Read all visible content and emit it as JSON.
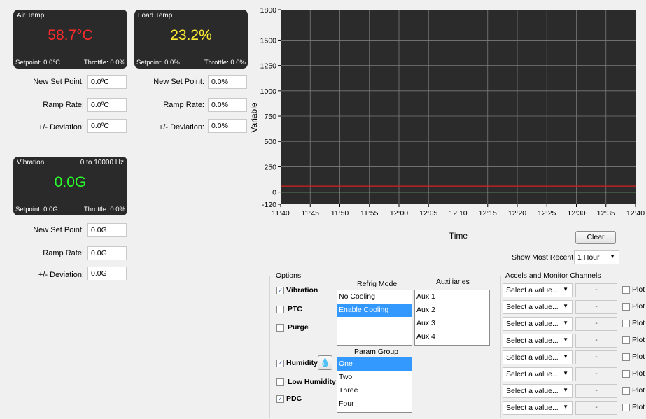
{
  "air": {
    "title": "Air Temp",
    "value": "58.7°C",
    "setpoint": "Setpoint: 0.0°C",
    "throttle": "Throttle: 0.0%",
    "color": "#ff2b2b"
  },
  "load": {
    "title": "Load Temp",
    "value": "23.2%",
    "setpoint": "Setpoint: 0.0%",
    "throttle": "Throttle: 0.0%",
    "color": "#ffee33"
  },
  "vib": {
    "title": "Vibration",
    "range": "0 to 10000 Hz",
    "value": "0.0G",
    "setpoint": "Setpoint: 0.0G",
    "throttle": "Throttle: 0.0%",
    "color": "#2bff2b"
  },
  "labels": {
    "new_set_point": "New Set Point:",
    "ramp_rate": "Ramp Rate:",
    "deviation": "+/- Deviation:"
  },
  "air_inputs": {
    "set_point": "0.0ºC",
    "ramp": "0.0ºC",
    "deviation": "0.0ºC"
  },
  "load_inputs": {
    "set_point": "0.0%",
    "ramp": "0.0%",
    "deviation": "0.0%"
  },
  "vib_inputs": {
    "set_point": "0.0G",
    "ramp": "0.0G",
    "deviation": "0.0G"
  },
  "chart_data": {
    "type": "line",
    "xlabel": "Time",
    "ylabel": "Variable",
    "ylim": [
      -120,
      1800
    ],
    "yticks": [
      "1800",
      "1500",
      "1250",
      "1000",
      "750",
      "500",
      "250",
      "0",
      "-120"
    ],
    "xticks": [
      "11:40",
      "11:45",
      "11:50",
      "11:55",
      "12:00",
      "12:05",
      "12:10",
      "12:15",
      "12:20",
      "12:25",
      "12:30",
      "12:35",
      "12:40"
    ],
    "series": [
      {
        "values": [
          58.7,
          58.7
        ],
        "color": "#d42020"
      },
      {
        "values": [
          0,
          0
        ],
        "color": "#7fd07f"
      }
    ],
    "grid": true
  },
  "clear_label": "Clear",
  "show_recent_label": "Show Most Recent:",
  "show_recent_value": "1 Hour",
  "options": {
    "title": "Options",
    "vibration": "Vibration",
    "ptc": "PTC",
    "purge": "Purge",
    "humidity": "Humidity",
    "low_humidity": "Low Humidity",
    "pdc": "PDC",
    "refrig_mode_title": "Refrig Mode",
    "refrig_items": [
      "No Cooling",
      "Enable Cooling"
    ],
    "aux_title": "Auxiliaries",
    "aux_items": [
      "Aux 1",
      "Aux 2",
      "Aux 3",
      "Aux 4"
    ],
    "param_title": "Param Group",
    "param_items": [
      "One",
      "Two",
      "Three",
      "Four"
    ]
  },
  "accels": {
    "title": "Accels and Monitor Channels",
    "select_placeholder": "Select a value...",
    "dash": "-",
    "plot_label": "Plot"
  }
}
